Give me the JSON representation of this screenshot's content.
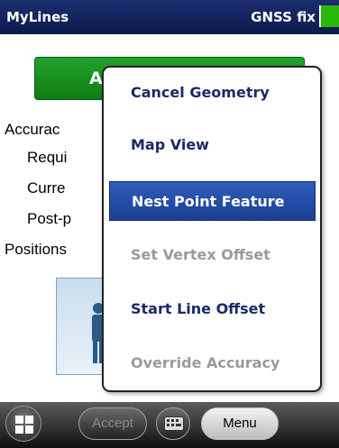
{
  "titlebar": {
    "app_title": "MyLines",
    "gnss_label": "GNSS fix",
    "gnss_color": "#27b80a"
  },
  "form": {
    "green_button_label": "A",
    "accuracy_label": "Accurac",
    "required_label": "Requi",
    "current_label": "Curre",
    "post_label": "Post-p",
    "positions_label": "Positions",
    "avatar_icon": "person-icon"
  },
  "menu": {
    "items": [
      {
        "label": "Cancel Geometry",
        "state": "enabled"
      },
      {
        "label": "Map View",
        "state": "enabled"
      },
      {
        "label": "Nest Point Feature",
        "state": "selected"
      },
      {
        "label": "Set Vertex Offset",
        "state": "disabled"
      },
      {
        "label": "Start Line Offset",
        "state": "enabled"
      },
      {
        "label": "Override Accuracy",
        "state": "disabled"
      }
    ]
  },
  "taskbar": {
    "start_icon": "windows-logo-icon",
    "accept_label": "Accept",
    "keyboard_icon": "keyboard-icon",
    "menu_label": "Menu"
  },
  "colors": {
    "titlebar": "#0d1b4d",
    "selected_item": "#2f5cb8",
    "menu_text": "#1a2a66",
    "disabled_text": "#9a9a9a"
  }
}
